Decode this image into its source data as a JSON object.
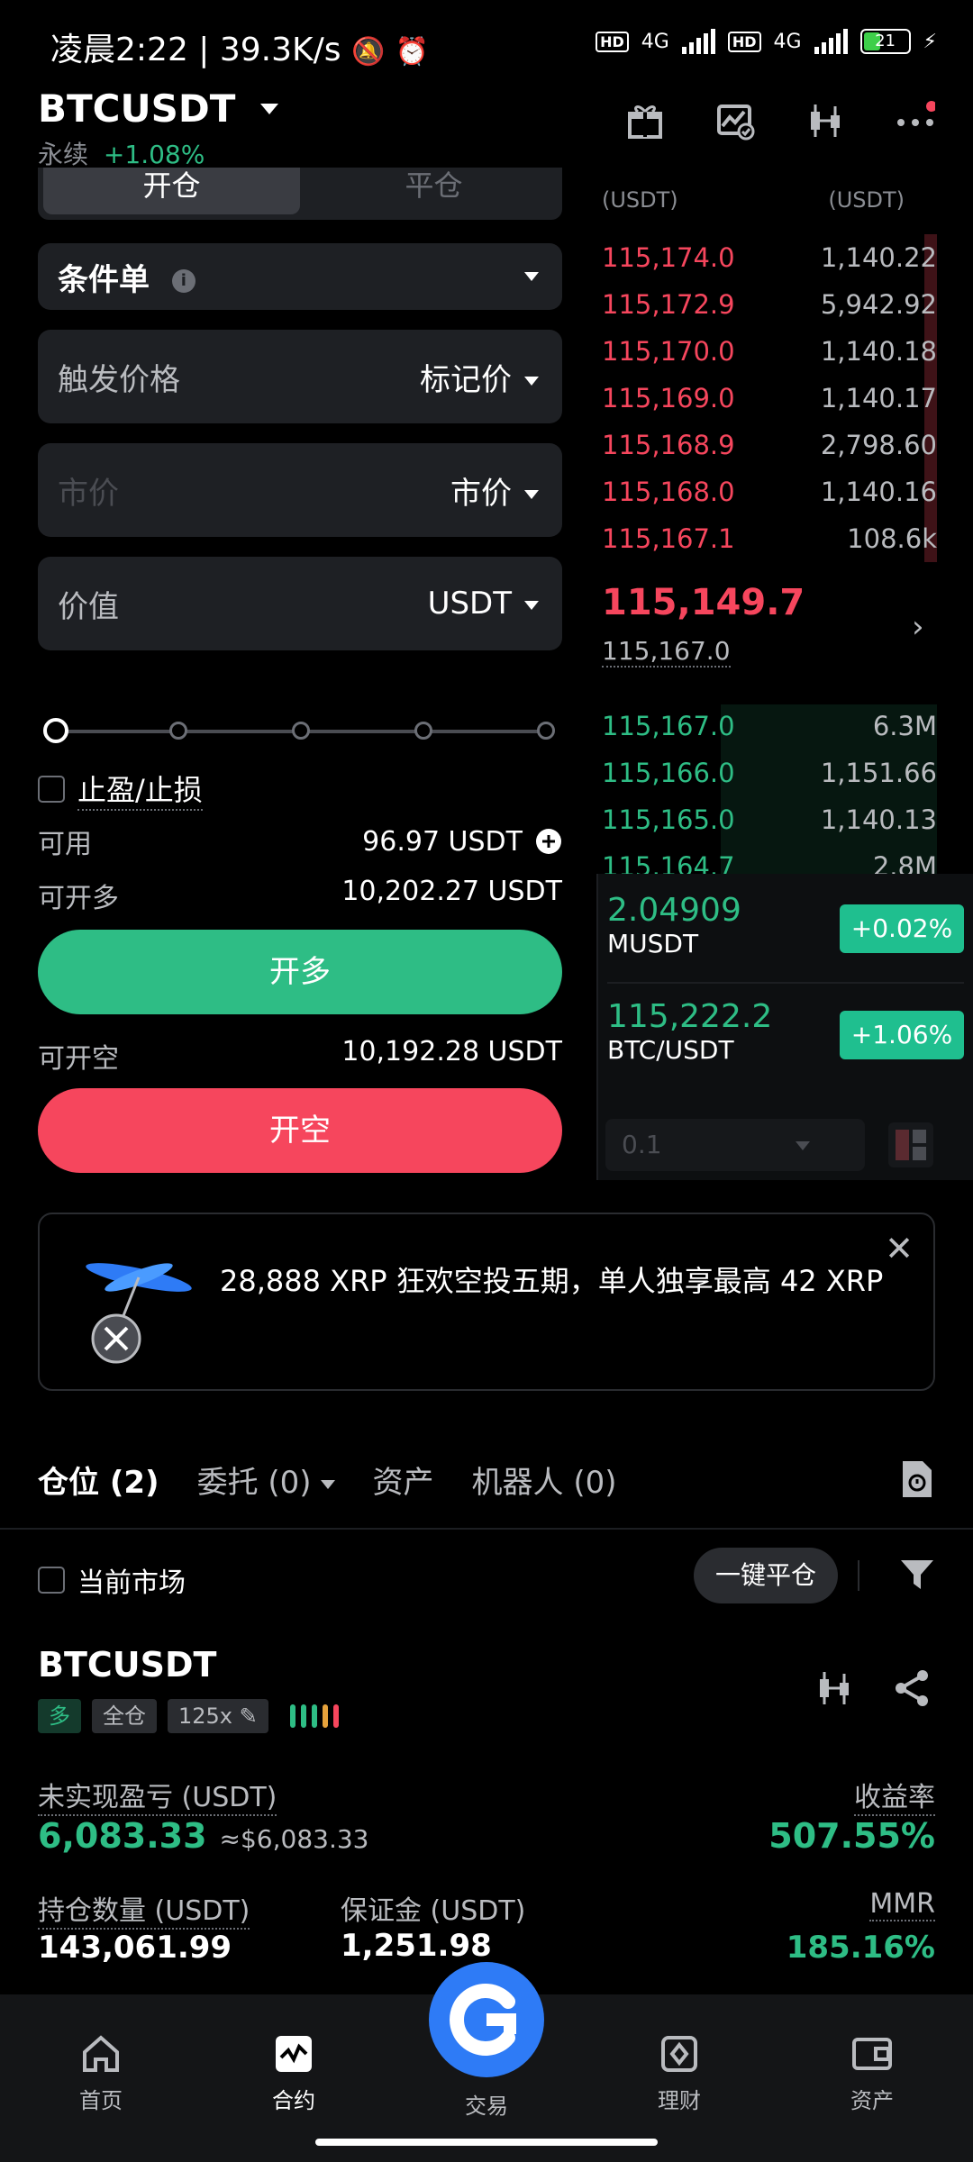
{
  "status_bar": {
    "time": "凌晨2:22",
    "speed": "39.3K/s",
    "network_1": "4G",
    "network_2": "4G",
    "hd": "HD",
    "battery": "21"
  },
  "header": {
    "symbol": "BTCUSDT",
    "market_type": "永续",
    "change": "+1.08%"
  },
  "order_form": {
    "tabs": [
      "开仓",
      "平仓"
    ],
    "order_type": "条件单",
    "info_glyph": "i",
    "trigger_label": "触发价格",
    "trigger_type": "标记价",
    "price_placeholder": "市价",
    "price_type": "市价",
    "value_label": "价值",
    "value_unit": "USDT",
    "tp_sl_label": "止盈/止损",
    "available_label": "可用",
    "available_value": "96.97  USDT",
    "can_long_label": "可开多",
    "can_long_value": "10,202.27 USDT",
    "long_button": "开多",
    "can_short_label": "可开空",
    "can_short_value": "10,192.28 USDT",
    "short_button": "开空"
  },
  "orderbook": {
    "col_price": "(USDT)",
    "col_qty": "(USDT)",
    "asks": [
      {
        "price": "115,174.0",
        "qty": "1,140.22"
      },
      {
        "price": "115,172.9",
        "qty": "5,942.92"
      },
      {
        "price": "115,170.0",
        "qty": "1,140.18"
      },
      {
        "price": "115,169.0",
        "qty": "1,140.17"
      },
      {
        "price": "115,168.9",
        "qty": "2,798.60"
      },
      {
        "price": "115,168.0",
        "qty": "1,140.16"
      },
      {
        "price": "115,167.1",
        "qty": "108.6k"
      }
    ],
    "last_price": "115,149.7",
    "mark_price": "115,167.0",
    "bids": [
      {
        "price": "115,167.0",
        "qty": "6.3M"
      },
      {
        "price": "115,166.0",
        "qty": "1,151.66"
      },
      {
        "price": "115,165.0",
        "qty": "1,140.13"
      },
      {
        "price": "115,164.7",
        "qty": "2.8M"
      }
    ],
    "depth_step": "0.1"
  },
  "float_ticker": [
    {
      "price": "2.04909",
      "name": "MUSDT",
      "change": "+0.02%"
    },
    {
      "price": "115,222.2",
      "name": "BTC/USDT",
      "change": "+1.06%"
    }
  ],
  "banner": {
    "text": "28,888 XRP 狂欢空投五期，单人独享最高 42 XRP",
    "close": "✕"
  },
  "positions_tabs": [
    "仓位 (2)",
    "委托 (0)",
    "资产",
    "机器人 (0)"
  ],
  "filter": {
    "current_market": "当前市场",
    "close_all": "一键平仓"
  },
  "position": {
    "symbol": "BTCUSDT",
    "side": "多",
    "margin_mode": "全仓",
    "leverage": "125x",
    "unrealized_label": "未实现盈亏 (USDT)",
    "unrealized_value": "6,083.33",
    "unrealized_approx": "≈$6,083.33",
    "roe_label": "收益率",
    "roe_value": "507.55%",
    "size_label": "持仓数量 (USDT)",
    "size_value": "143,061.99",
    "margin_label": "保证金 (USDT)",
    "margin_value": "1,251.98",
    "mmr_label": "MMR",
    "mmr_value": "185.16%"
  },
  "bottom_nav": [
    "首页",
    "合约",
    "交易",
    "理财",
    "资产"
  ],
  "colors": {
    "green": "#2ebd85",
    "red": "#f6465d",
    "fab_blue": "#2e7bf6"
  }
}
